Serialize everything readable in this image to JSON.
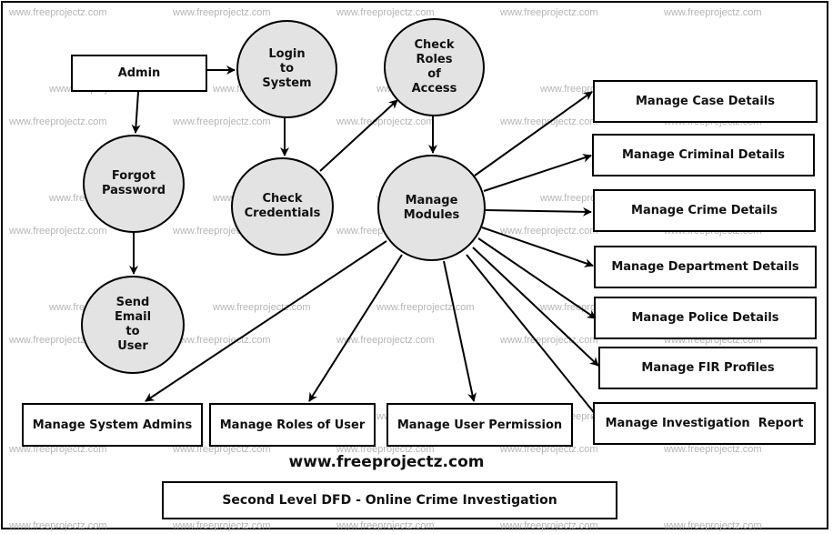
{
  "diagram": {
    "title": "Second Level DFD - Online Crime Investigation",
    "website": "www.freeprojectz.com",
    "watermark": "www.freeprojectz.com",
    "entities": {
      "admin": "Admin"
    },
    "processes": {
      "login": "Login\nto\nSystem",
      "check_roles": "Check\nRoles\nof\nAccess",
      "forgot_password": "Forgot\nPassword",
      "check_credentials": "Check\nCredentials",
      "manage_modules": "Manage\nModules",
      "send_email": "Send\nEmail\nto\nUser"
    },
    "modules": {
      "case": "Manage Case Details",
      "criminal": "Manage Criminal Details",
      "crime": "Manage Crime Details",
      "department": "Manage Department Details",
      "police": "Manage Police Details",
      "fir": "Manage FIR Profiles",
      "investigation": "Manage Investigation  Report",
      "system_admins": "Manage System Admins",
      "roles": "Manage Roles of User",
      "permission": "Manage User Permission"
    },
    "flows": [
      {
        "from": "admin",
        "to": "login"
      },
      {
        "from": "admin",
        "to": "forgot_password"
      },
      {
        "from": "login",
        "to": "check_credentials"
      },
      {
        "from": "check_credentials",
        "to": "check_roles"
      },
      {
        "from": "check_roles",
        "to": "manage_modules"
      },
      {
        "from": "forgot_password",
        "to": "send_email"
      },
      {
        "from": "manage_modules",
        "to": "case"
      },
      {
        "from": "manage_modules",
        "to": "criminal"
      },
      {
        "from": "manage_modules",
        "to": "crime"
      },
      {
        "from": "manage_modules",
        "to": "department"
      },
      {
        "from": "manage_modules",
        "to": "police"
      },
      {
        "from": "manage_modules",
        "to": "fir"
      },
      {
        "from": "manage_modules",
        "to": "investigation"
      },
      {
        "from": "manage_modules",
        "to": "system_admins"
      },
      {
        "from": "manage_modules",
        "to": "roles"
      },
      {
        "from": "manage_modules",
        "to": "permission"
      }
    ]
  }
}
